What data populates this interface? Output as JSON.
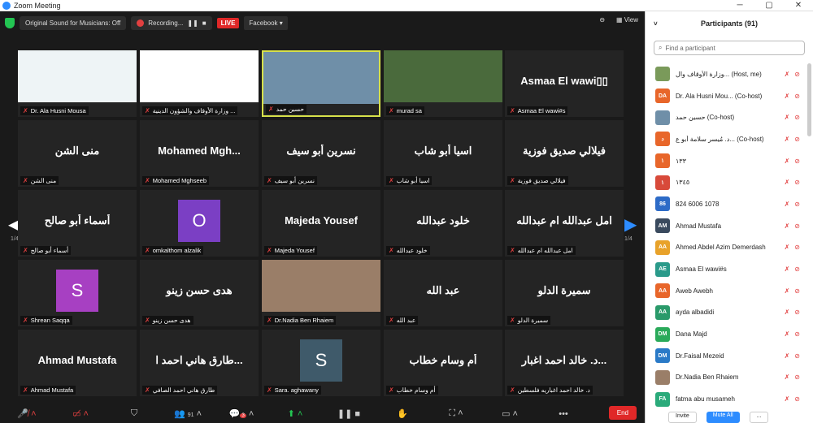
{
  "window": {
    "title": "Zoom Meeting"
  },
  "topbar": {
    "original_sound": "Original Sound for Musicians: Off",
    "recording": "Recording...",
    "live": "LIVE",
    "facebook": "Facebook ▾",
    "view": "View"
  },
  "grid": {
    "page_left": "1/4",
    "page_right": "1/4",
    "tiles": [
      {
        "label": "Dr. Ala Husni Mousa",
        "big": "",
        "kind": "photo",
        "color": "#eef4f6"
      },
      {
        "label": "وزارة الأوقاف والشؤون الدينية ...",
        "big": "",
        "kind": "logo",
        "color": "#ffffff"
      },
      {
        "label": "حسين حمد",
        "big": "",
        "kind": "photo",
        "color": "#6f8fa8",
        "active": true
      },
      {
        "label": "murad sa",
        "big": "",
        "kind": "photo",
        "color": "#4a6a3c"
      },
      {
        "label": "Asmaa El wawi#s",
        "big": "Asmaa  El  wawi▯▯",
        "kind": "text"
      },
      {
        "label": "منى الشن",
        "big": "منى الشن",
        "kind": "text"
      },
      {
        "label": "Mohamed Mghseeb",
        "big": "Mohamed  Mgh...",
        "kind": "text"
      },
      {
        "label": "نسرين أبو سيف",
        "big": "نسرين أبو سيف",
        "kind": "text"
      },
      {
        "label": "اسيا أبو شاب",
        "big": "اسيا أبو شاب",
        "kind": "text"
      },
      {
        "label": "فيلالي صديق فوزية",
        "big": "فيلالي صديق فوزية",
        "kind": "text"
      },
      {
        "label": "أسماء أبو صالح",
        "big": "أسماء أبو صالح",
        "kind": "text"
      },
      {
        "label": "omkalthom alzalik",
        "big": "O",
        "kind": "avatar",
        "color": "#7b3fc4"
      },
      {
        "label": "Majeda Yousef",
        "big": "Majeda Yousef",
        "kind": "text"
      },
      {
        "label": "خلود عبدالله",
        "big": "خلود عبدالله",
        "kind": "text"
      },
      {
        "label": "امل عبدالله ام عبدالله",
        "big": "امل عبدالله ام عبدالله",
        "kind": "text"
      },
      {
        "label": "Shrean Saqqa",
        "big": "S",
        "kind": "avatar",
        "color": "#a740c2"
      },
      {
        "label": "هدى حسن زينو",
        "big": "هدى حسن زينو",
        "kind": "text"
      },
      {
        "label": "Dr.Nadia Ben Rhaiem",
        "big": "",
        "kind": "photo",
        "color": "#9a7e68"
      },
      {
        "label": "عبد الله",
        "big": "عبد الله",
        "kind": "text"
      },
      {
        "label": "سميرة الدلو",
        "big": "سميرة الدلو",
        "kind": "text"
      },
      {
        "label": "Ahmad Mustafa",
        "big": "Ahmad Mustafa",
        "kind": "text"
      },
      {
        "label": "طارق هاني احمد الصافي",
        "big": "طارق هاني احمد ا...",
        "kind": "text"
      },
      {
        "label": "Sara. aghawany",
        "big": "S",
        "kind": "avatar",
        "color": "#3f5a6a"
      },
      {
        "label": "أم وسام خطاب",
        "big": "أم وسام خطاب",
        "kind": "text"
      },
      {
        "label": "د. خالد احمد اغباريه فلسطين",
        "big": "د. خالد احمد اغبار...",
        "kind": "text"
      }
    ]
  },
  "toolbar": {
    "participants_count": "91",
    "chat_badge": "3",
    "end": "End"
  },
  "panel": {
    "title": "Participants (91)",
    "search_placeholder": "Find a participant",
    "invite": "Invite",
    "mute_all": "Mute All",
    "more": "...",
    "participants": [
      {
        "initials": "",
        "name": "وزارة الأوقاف وال... (Host, me)",
        "color": "#7a9a5a"
      },
      {
        "initials": "DA",
        "name": "Dr. Ala Husni Mou... (Co-host)",
        "color": "#e8662a"
      },
      {
        "initials": "",
        "name": "حسين حمد (Co-host)",
        "color": "#6f8fa8"
      },
      {
        "initials": "د",
        "name": "د. مُيسر سلامة أبو ع... (Co-host)",
        "color": "#e8662a"
      },
      {
        "initials": "١",
        "name": "١٣٣",
        "color": "#e8662a"
      },
      {
        "initials": "١",
        "name": "١٣٤٥",
        "color": "#d84a3a"
      },
      {
        "initials": "86",
        "name": "824 6006 1078",
        "color": "#2d6bc7"
      },
      {
        "initials": "AM",
        "name": "Ahmad Mustafa",
        "color": "#3a4a5e"
      },
      {
        "initials": "AA",
        "name": "Ahmed Abdel Azim Demerdash",
        "color": "#e8a22a"
      },
      {
        "initials": "AE",
        "name": "Asmaa El wawi#s",
        "color": "#2a9a8a"
      },
      {
        "initials": "AA",
        "name": "Aweb Awebh",
        "color": "#e8662a"
      },
      {
        "initials": "AA",
        "name": "ayda albadidi",
        "color": "#2a9a6a"
      },
      {
        "initials": "DM",
        "name": "Dana Majd",
        "color": "#2aaa5a"
      },
      {
        "initials": "DM",
        "name": "Dr.Faisal Mezeid",
        "color": "#2a7ac7"
      },
      {
        "initials": "",
        "name": "Dr.Nadia Ben Rhaiem",
        "color": "#9a7e68"
      },
      {
        "initials": "FA",
        "name": "fatma abu musameh",
        "color": "#2aaa7a"
      }
    ]
  }
}
